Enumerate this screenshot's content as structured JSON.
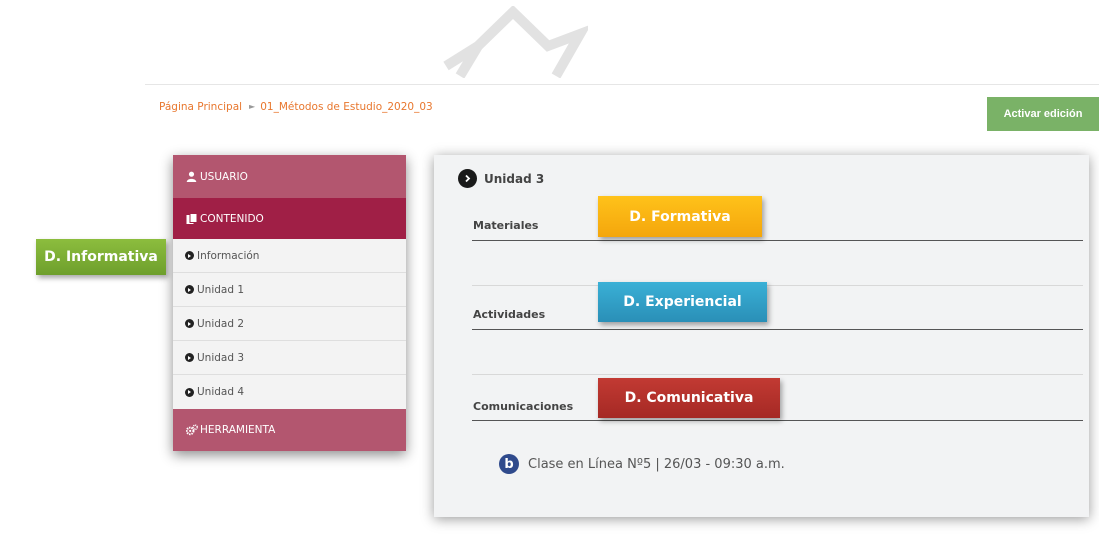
{
  "breadcrumb": {
    "home": "Página Principal",
    "separator": "►",
    "course": "01_Métodos de Estudio_2020_03"
  },
  "header": {
    "edit_button": "Activar edición"
  },
  "sidebar": {
    "usuario": "USUARIO",
    "contenido": "CONTENIDO",
    "items": [
      {
        "label": "Información"
      },
      {
        "label": "Unidad 1"
      },
      {
        "label": "Unidad 2"
      },
      {
        "label": "Unidad 3"
      },
      {
        "label": "Unidad 4"
      }
    ],
    "herramienta": "HERRAMIENTA"
  },
  "main": {
    "unit_title": "Unidad 3",
    "sections": [
      "Materiales",
      "Actividades",
      "Comunicaciones"
    ],
    "session": "Clase en Línea Nº5 | 26/03 - 09:30 a.m."
  },
  "tags": {
    "informativa": "D. Informativa",
    "formativa": "D. Formativa",
    "experiencial": "D. Experiencial",
    "comunicativa": "D. Comunicativa"
  },
  "colors": {
    "breadcrumb": "#e8772e",
    "edit_button": "#7ab267",
    "sidebar_header": "#b3566f",
    "sidebar_active": "#a01f46",
    "tag_informativa": "#7cae34",
    "tag_formativa": "#fbb414",
    "tag_experiencial": "#32a0c8",
    "tag_comunicativa": "#b8322c"
  },
  "icons": {
    "logo": "crown-logo",
    "user": "user-icon",
    "content": "files-icon",
    "tools": "cogs-icon",
    "item": "chevron-circle-icon",
    "session": "blackboard-collaborate-icon"
  }
}
